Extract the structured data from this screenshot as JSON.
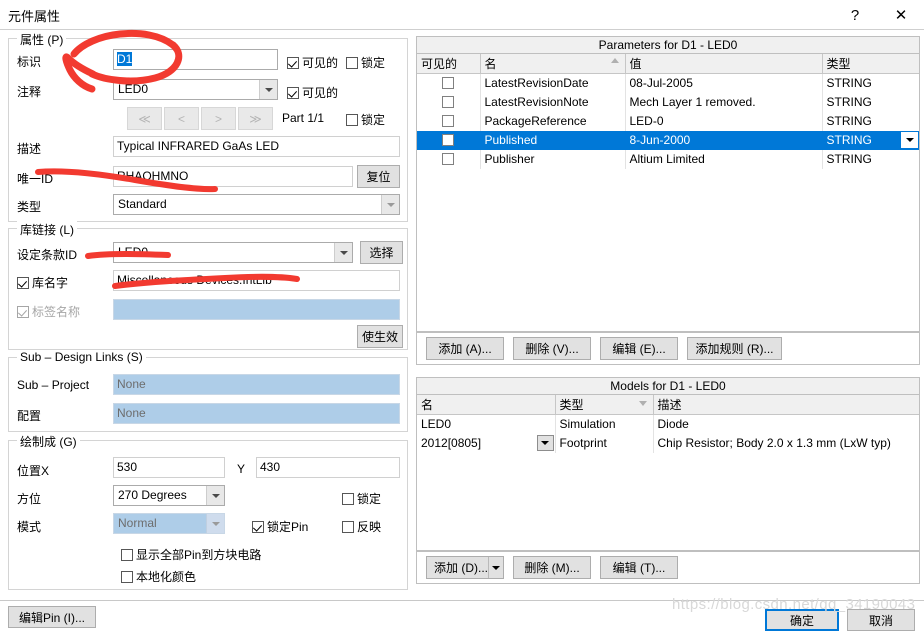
{
  "window": {
    "title": "元件属性",
    "help_icon": "?",
    "close_icon": "✕"
  },
  "properties_group": {
    "legend": "属性 (P)",
    "designator": {
      "label": "标识",
      "value": "D1",
      "visible_label": "可见的",
      "visible_checked": true,
      "locked_label": "锁定",
      "locked_checked": false
    },
    "comment": {
      "label": "注释",
      "value": "LED0",
      "visible_label": "可见的",
      "visible_checked": true
    },
    "part_nav": {
      "first": "≪",
      "prev": "<",
      "next": ">",
      "last": "≫",
      "part_text": "Part 1/1",
      "locked_label": "锁定",
      "locked_checked": false
    },
    "description": {
      "label": "描述",
      "value": "Typical INFRARED GaAs LED"
    },
    "unique_id": {
      "label": "唯一ID",
      "value": "RHAOHMNO",
      "reset_button": "复位"
    },
    "type": {
      "label": "类型",
      "value": "Standard"
    }
  },
  "library_group": {
    "legend": "库链接 (L)",
    "design_item_id": {
      "label": "设定条款ID",
      "value": "LED0",
      "choose_button": "选择"
    },
    "library_name": {
      "label": "库名字",
      "checked": true,
      "value": "Miscellaneous Devices.IntLib"
    },
    "vault_name": {
      "label": "标签名称",
      "checked": true,
      "enabled": false,
      "value": ""
    },
    "validate_button": "使生效"
  },
  "sub_design_group": {
    "legend": "Sub – Design Links (S)",
    "sub_project": {
      "label": "Sub – Project",
      "value": "None"
    },
    "configuration": {
      "label": "配置",
      "value": "None"
    }
  },
  "graphical_group": {
    "legend": "绘制成 (G)",
    "location_x": {
      "label": "位置X",
      "value": "530"
    },
    "location_y": {
      "label": "Y",
      "value": "430"
    },
    "orientation": {
      "label": "方位",
      "value": "270 Degrees"
    },
    "mode": {
      "label": "模式",
      "value": "Normal",
      "enabled": false
    },
    "mirrored": {
      "label": "反映",
      "checked": false
    },
    "locked": {
      "label": "锁定",
      "checked": false
    },
    "pins_locked": {
      "label": "锁定Pin",
      "checked": true
    },
    "show_all_pins": {
      "label": "显示全部Pin到方块电路",
      "checked": false
    },
    "local_colors": {
      "label": "本地化颜色",
      "checked": false
    }
  },
  "edit_pins_button": "编辑Pin (I)...",
  "parameters_pane": {
    "title": "Parameters for D1 - LED0",
    "columns": [
      "可见的",
      "名",
      "值",
      "类型"
    ],
    "sort_column_index": 1,
    "rows": [
      {
        "visible": false,
        "name": "LatestRevisionDate",
        "value": "08-Jul-2005",
        "type": "STRING",
        "selected": false
      },
      {
        "visible": false,
        "name": "LatestRevisionNote",
        "value": "Mech Layer 1 removed.",
        "type": "STRING",
        "selected": false
      },
      {
        "visible": false,
        "name": "PackageReference",
        "value": "LED-0",
        "type": "STRING",
        "selected": false
      },
      {
        "visible": false,
        "name": "Published",
        "value": "8-Jun-2000",
        "type": "STRING",
        "selected": true
      },
      {
        "visible": false,
        "name": "Publisher",
        "value": "Altium Limited",
        "type": "STRING",
        "selected": false
      }
    ],
    "buttons": [
      "添加 (A)...",
      "删除 (V)...",
      "编辑 (E)...",
      "添加规则 (R)..."
    ]
  },
  "models_pane": {
    "title": "Models for D1 - LED0",
    "columns": [
      "名",
      "类型",
      "描述"
    ],
    "sort_column_index": 1,
    "rows": [
      {
        "name": "LED0",
        "type": "Simulation",
        "description": "Diode",
        "has_dropdown": false
      },
      {
        "name": "2012[0805]",
        "type": "Footprint",
        "description": "Chip Resistor; Body 2.0 x 1.3 mm (LxW typ)",
        "has_dropdown": true
      }
    ],
    "buttons": [
      "添加 (D)...",
      "删除 (M)...",
      "编辑 (T)..."
    ]
  },
  "dialog_buttons": {
    "ok": "确定",
    "cancel": "取消"
  },
  "watermark": "https://blog.csdn.net/qq_34190043",
  "colors": {
    "selection_blue": "#0078d7",
    "disabled_field_blue": "#aecde8",
    "annotation_red": "#f23a30",
    "panel_border": "#bfbfbf",
    "header_grey": "#f0f0f0"
  }
}
